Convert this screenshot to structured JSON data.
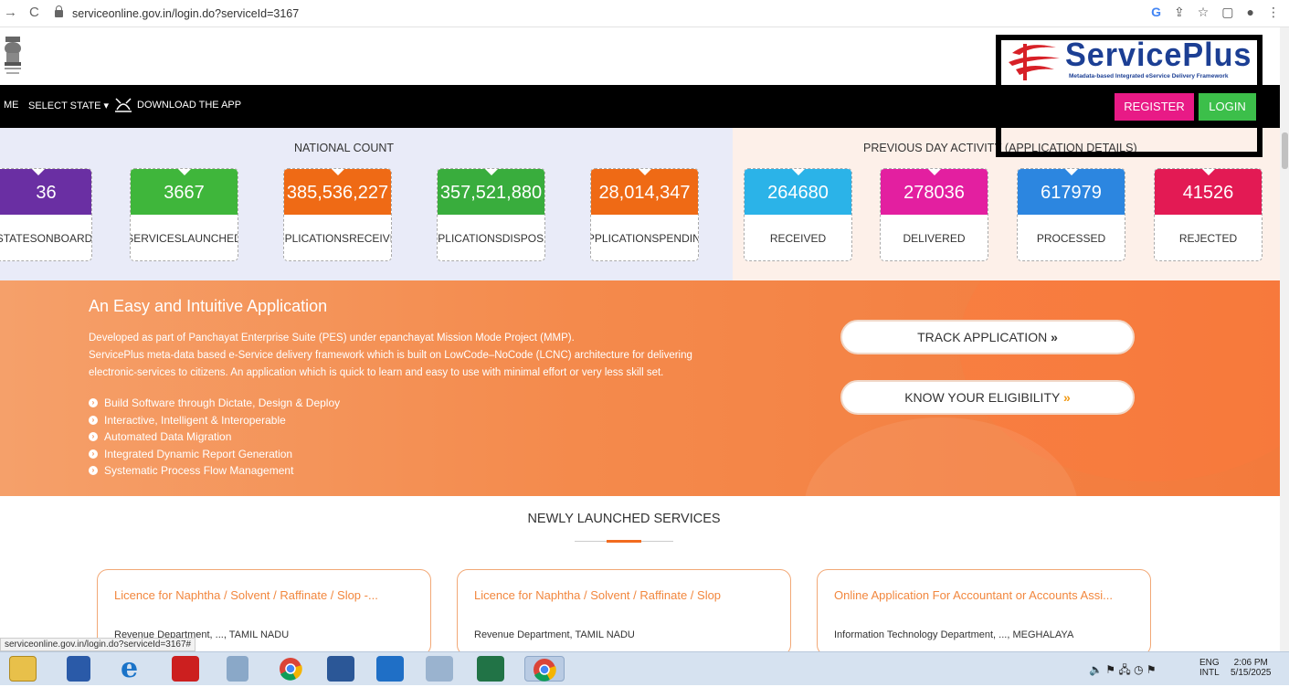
{
  "browser": {
    "url": "serviceonline.gov.in/login.do?serviceId=3167",
    "status_url": "serviceonline.gov.in/login.do?serviceId=3167#"
  },
  "brand": {
    "name": "ServicePlus",
    "tagline": "Metadata-based Integrated eService Delivery Framework",
    "colors": {
      "primary": "#1c3f94",
      "swoosh": "#d72027"
    }
  },
  "nav": {
    "home": "ME",
    "select_state": "SELECT STATE",
    "download": "DOWNLOAD THE APP",
    "register": "REGISTER",
    "login": "LOGIN"
  },
  "national_count": {
    "title": "NATIONAL COUNT",
    "stats": [
      {
        "value": "36",
        "label_line1": "STATES",
        "label_line2": "ONBOARD",
        "color": "#6a2fa3"
      },
      {
        "value": "3667",
        "label_line1": "SERVICES",
        "label_line2": "LAUNCHED",
        "color": "#3fb63b"
      },
      {
        "value": "385,536,227",
        "label_line1": "APPLICATIONS",
        "label_line2": "RECEIVED",
        "color": "#ef6a15"
      },
      {
        "value": "357,521,880",
        "label_line1": "APPLICATIONS",
        "label_line2": "DISPOSED",
        "color": "#39ad3d"
      },
      {
        "value": "28,014,347",
        "label_line1": "APPLICATIONS",
        "label_line2": "PENDING",
        "color": "#ef6a15"
      }
    ]
  },
  "previous_day": {
    "title": "PREVIOUS DAY ACTIVITY (APPLICATION DETAILS)",
    "stats": [
      {
        "value": "264680",
        "label": "RECEIVED",
        "color": "#2bb3e8"
      },
      {
        "value": "278036",
        "label": "DELIVERED",
        "color": "#e31fa0"
      },
      {
        "value": "617979",
        "label": "PROCESSED",
        "color": "#2c86e0"
      },
      {
        "value": "41526",
        "label": "REJECTED",
        "color": "#e31a54"
      }
    ]
  },
  "banner": {
    "title": "An Easy and Intuitive Application",
    "para1": "Developed as part of Panchayat Enterprise Suite (PES) under epanchayat Mission Mode Project (MMP).",
    "para2": "ServicePlus meta-data based e-Service delivery framework which is built on LowCode–NoCode (LCNC) architecture for delivering",
    "para3": "electronic-services to citizens. An application which is quick to learn and easy to use with minimal effort or very less skill set.",
    "features": [
      "Build Software through Dictate, Design & Deploy",
      "Interactive, Intelligent & Interoperable",
      "Automated Data Migration",
      "Integrated Dynamic Report Generation",
      "Systematic Process Flow Management"
    ],
    "track_button": "TRACK APPLICATION",
    "eligibility_button": "KNOW YOUR ELIGIBILITY",
    "chevron": "»"
  },
  "newly_launched": {
    "title": "NEWLY LAUNCHED SERVICES",
    "cards": [
      {
        "title": "Licence for Naphtha / Solvent / Raffinate / Slop -...",
        "dept": "Revenue Department, ..., TAMIL NADU"
      },
      {
        "title": "Licence for Naphtha / Solvent / Raffinate / Slop",
        "dept": "Revenue Department, TAMIL NADU"
      },
      {
        "title": "Online Application For Accountant or Accounts Assi...",
        "dept": "Information Technology Department, ..., MEGHALAYA"
      }
    ]
  },
  "taskbar": {
    "lang1": "ENG",
    "lang2": "INTL",
    "time": "2:06 PM",
    "date": "5/15/2025"
  }
}
